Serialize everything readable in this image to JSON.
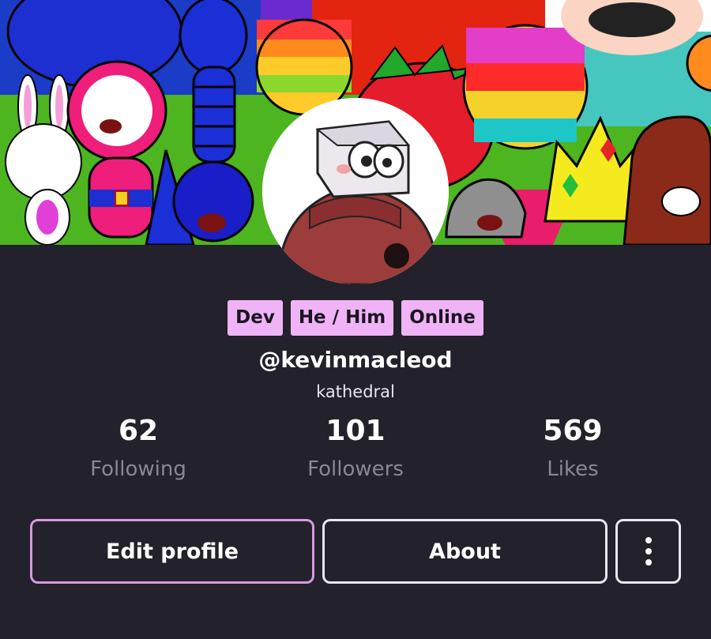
{
  "profile": {
    "badges": [
      "Dev",
      "He / Him",
      "Online"
    ],
    "handle": "@kevinmacleod",
    "display_name": "kathedral"
  },
  "stats": {
    "following": {
      "value": "62",
      "label": "Following"
    },
    "followers": {
      "value": "101",
      "label": "Followers"
    },
    "likes": {
      "value": "569",
      "label": "Likes"
    }
  },
  "actions": {
    "edit_label": "Edit profile",
    "about_label": "About",
    "more_icon": "more-vertical-icon"
  },
  "colors": {
    "background": "#23212b",
    "badge": "#f0b4f6",
    "edit_border": "#d59be0",
    "muted_text": "#8a8794"
  }
}
